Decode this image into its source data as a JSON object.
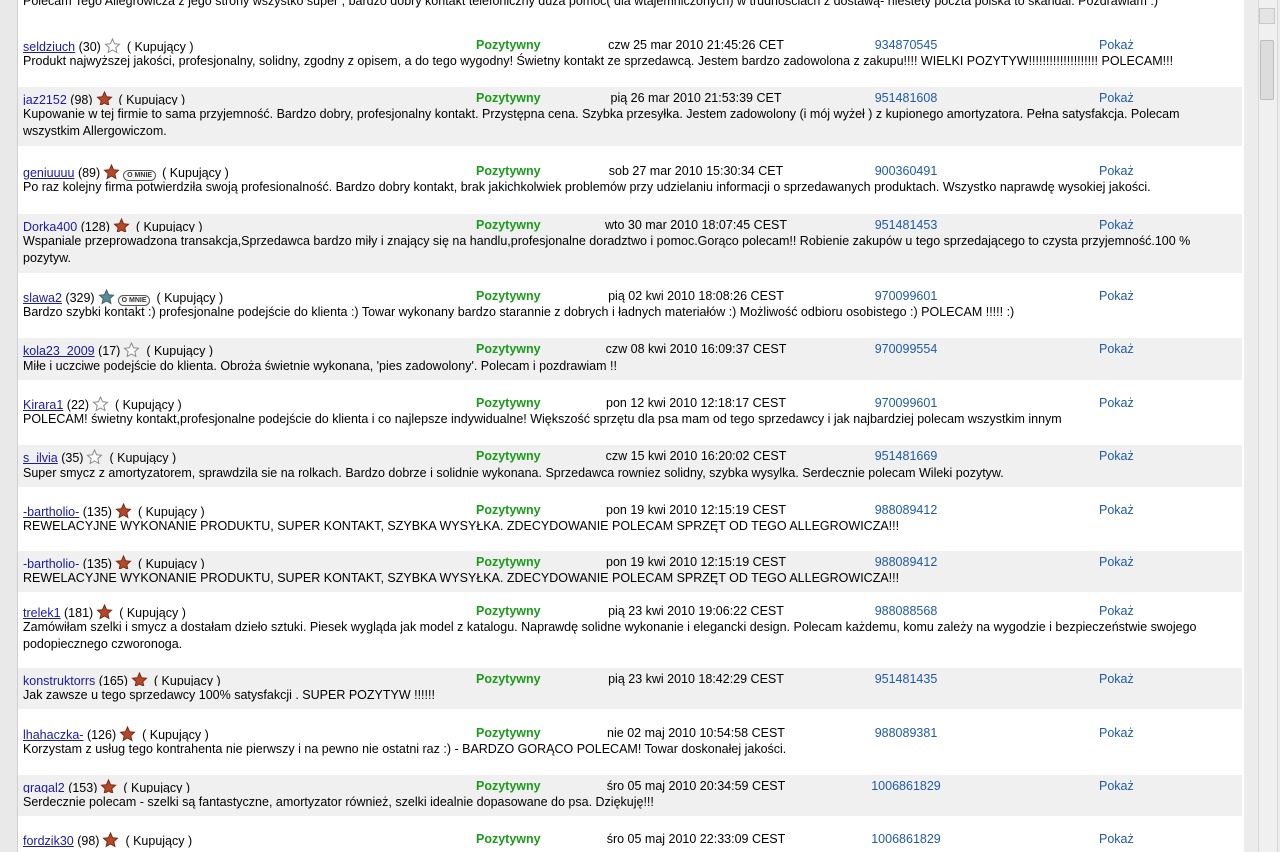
{
  "intro_text": "Polecam Tego Allegrowicza z jego strony wszystko super , bardzo dobry kontakt telefoniczny duża pomoc( dla wtajemniczonych) w trudnościach z dostawą- niestety poczta polska to skandal. Pozdrawiam :)",
  "labels": {
    "role": "( Kupujący )",
    "type": "Pozytywny",
    "show": "Pokaż",
    "about_me_badge": "O MNIE"
  },
  "colors": {
    "link": "#1a1aa6",
    "positive": "#1b9b1b",
    "auction": "#1f5aa8",
    "star_colored": "#b5482a",
    "star_teal": "#5a8a96"
  },
  "entries": [
    {
      "user": "seldziuch",
      "score": "(30)",
      "star": "outline",
      "badge": false,
      "date": "czw 25 mar 2010 21:45:26 CET",
      "auction": "934870545",
      "comment": "Produkt najwyższej jakości, profesjonalny, solidny, zgodny z opisem, a do tego wygodny! Świetny kontakt ze sprzedawcą. Jestem bardzo zadowolona z zakupu!!!! WIELKI POZYTYW!!!!!!!!!!!!!!!!!!!! POLECAM!!!"
    },
    {
      "user": "jaz2152",
      "score": "(98)",
      "star": "filled",
      "badge": false,
      "date": "pią 26 mar 2010 21:53:39 CET",
      "auction": "951481608",
      "comment": "Kupowanie w tej firmie to sama przyjemność. Bardzo dobry, profesjonalny kontakt. Przystępna cena. Szybka przesyłka. Jestem zadowolony (i mój wyżeł ) z kupionego amortyzatora. Pełna satysfakcja. Polecam wszystkim Allergowiczom."
    },
    {
      "user": "geniuuuu",
      "score": "(89)",
      "star": "filled",
      "badge": true,
      "date": "sob 27 mar 2010 15:30:34 CET",
      "auction": "900360491",
      "comment": "Po raz kolejny firma potwierdziła swoją profesionalność. Bardzo dobry kontakt, brak jakichkolwiek problemów przy udzielaniu informacji o sprzedawanych produktach. Wszystko naprawdę wysokiej jakości."
    },
    {
      "user": "Dorka400",
      "score": "(128)",
      "star": "filled",
      "badge": false,
      "date": "wto 30 mar 2010 18:07:45 CEST",
      "auction": "951481453",
      "comment": "Wspaniale przeprowadzona transakcja,Sprzedawca bardzo miły i znający się na handlu,profesjonalne doradztwo i pomoc.Gorąco polecam!! Robienie zakupów u tego sprzedającego to czysta przyjemność.100 % pozytyw."
    },
    {
      "user": "slawa2",
      "score": "(329)",
      "star": "teal",
      "badge": true,
      "date": "pią 02 kwi 2010 18:08:26 CEST",
      "auction": "970099601",
      "comment": "Bardzo szybki kontakt :) profesjonalne podejście do klienta :) Towar wykonany bardzo starannie z dobrych i ładnych materiałów :) Możliwość odbioru osobistego :) POLECAM !!!!! :)"
    },
    {
      "user": "kola23_2009",
      "score": "(17)",
      "star": "outline",
      "badge": false,
      "date": "czw 08 kwi 2010 16:09:37 CEST",
      "auction": "970099554",
      "comment": "Miłe i uczciwe podejście do klienta. Obroża świetnie wykonana, 'pies zadowolony'. Polecam i pozdrawiam !!"
    },
    {
      "user": "Kirara1",
      "score": "(22)",
      "star": "outline",
      "badge": false,
      "date": "pon 12 kwi 2010 12:18:17 CEST",
      "auction": "970099601",
      "comment": "POLECAM! świetny kontakt,profesjonalne podejście do klienta i co najlepsze indywidualne! Większość sprzętu dla psa mam od tego sprzedawcy i jak najbardziej polecam wszystkim innym"
    },
    {
      "user": "s_ilvia",
      "score": "(35)",
      "star": "outline",
      "badge": false,
      "date": "czw 15 kwi 2010 16:20:02 CEST",
      "auction": "951481669",
      "comment": "Super smycz z amortyzatorem, sprawdzila sie na rolkach. Bardzo dobrze i solidnie wykonana. Sprzedawca rowniez solidny, szybka wysylka. Serdecznie polecam Wileki pozytyw."
    },
    {
      "user": "-bartholio-",
      "score": "(135)",
      "star": "filled",
      "badge": false,
      "date": "pon 19 kwi 2010 12:15:19 CEST",
      "auction": "988089412",
      "comment": "REWELACYJNE WYKONANIE PRODUKTU, SUPER KONTAKT, SZYBKA WYSYŁKA. ZDECYDOWANIE POLECAM SPRZĘT OD TEGO ALLEGROWICZA!!!"
    },
    {
      "user": "-bartholio-",
      "score": "(135)",
      "star": "filled",
      "badge": false,
      "date": "pon 19 kwi 2010 12:15:19 CEST",
      "auction": "988089412",
      "comment": "REWELACYJNE WYKONANIE PRODUKTU, SUPER KONTAKT, SZYBKA WYSYŁKA. ZDECYDOWANIE POLECAM SPRZĘT OD TEGO ALLEGROWICZA!!!"
    },
    {
      "user": "trelek1",
      "score": "(181)",
      "star": "filled",
      "badge": false,
      "date": "pią 23 kwi 2010 19:06:22 CEST",
      "auction": "988088568",
      "comment": "Zamówiłam szelki i smycz a dostałam dzieło sztuki. Piesek wygląda jak model z katalogu. Naprawdę solidne wykonanie i elegancki design. Polecam każdemu, komu zależy na wygodzie i bezpieczeństwie swojego podopiecznego czworonoga."
    },
    {
      "user": "konstruktorrs",
      "score": "(165)",
      "star": "filled",
      "badge": false,
      "date": "pią 23 kwi 2010 18:42:29 CEST",
      "auction": "951481435",
      "comment": "Jak zawsze u tego sprzedawcy 100% satysfakcji . SUPER POZYTYW !!!!!!"
    },
    {
      "user": "lhahaczka-",
      "score": "(126)",
      "star": "filled",
      "badge": false,
      "date": "nie 02 maj 2010 10:54:58 CEST",
      "auction": "988089381",
      "comment": "Korzystam z usług tego kontrahenta nie pierwszy i na pewno nie ostatni raz :) - BARDZO GORĄCO POLECAM! Towar doskonałej jakości."
    },
    {
      "user": "gragal2",
      "score": "(153)",
      "star": "filled",
      "badge": false,
      "date": "śro 05 maj 2010 20:34:59 CEST",
      "auction": "1006861829",
      "comment": "Serdecznie polecam - szelki są fantastyczne, amortyzator również, szelki idealnie dopasowane do psa. Dziękuję!!!"
    },
    {
      "user": "fordzik30",
      "score": "(98)",
      "star": "filled",
      "badge": false,
      "date": "śro 05 maj 2010 22:33:09 CEST",
      "auction": "1006861829",
      "comment": ""
    }
  ]
}
